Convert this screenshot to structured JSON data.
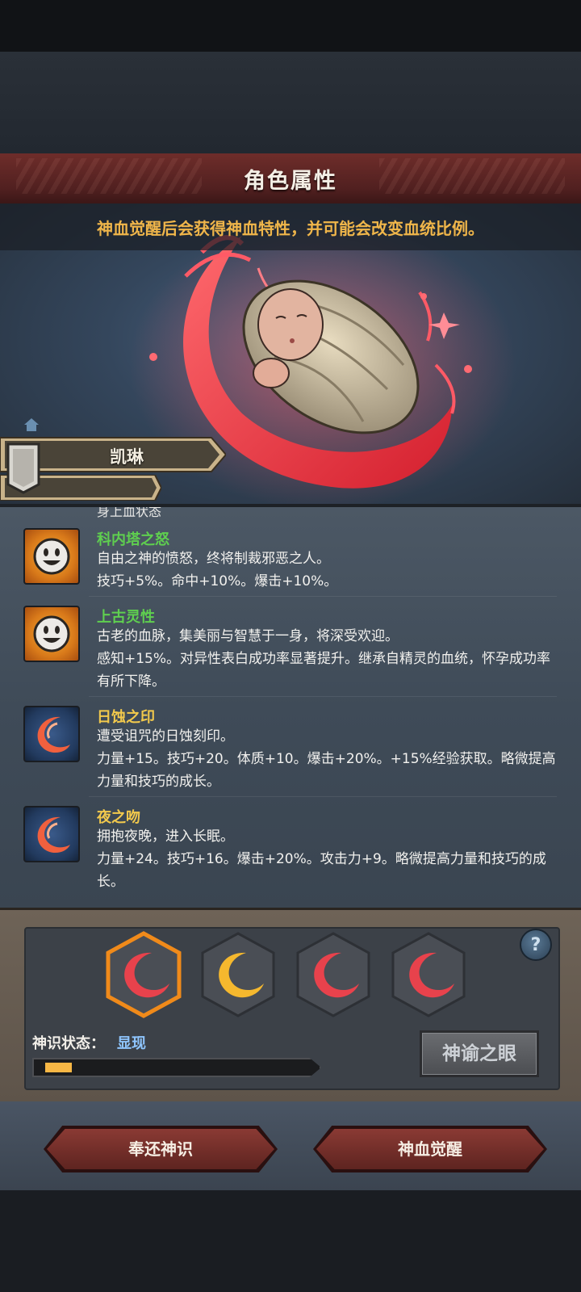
{
  "header": {
    "title": "角色属性"
  },
  "subtitle": "神血觉醒后会获得神血特性，并可能会改变血统比例。",
  "character": {
    "name": "凯琳"
  },
  "traits_list": {
    "clipped_text": "身上血状态",
    "items": [
      {
        "name": "科内塔之怒",
        "name_color": "#5fcf4f",
        "icon": "smiley-sun-icon",
        "description": "自由之神的愤怒，终将制裁邪恶之人。",
        "effects": "技巧+5%。命中+10%。爆击+10%。"
      },
      {
        "name": "上古灵性",
        "name_color": "#5fcf4f",
        "icon": "smiley-sun-icon",
        "description": "古老的血脉，集美丽与智慧于一身，将深受欢迎。",
        "effects": "感知+15%。对异性表白成功率显著提升。继承自精灵的血统，怀孕成功率有所下降。"
      },
      {
        "name": "日蚀之印",
        "name_color": "#f2c94c",
        "icon": "crimson-crescent-icon",
        "description": "遭受诅咒的日蚀刻印。",
        "effects": "力量+15。技巧+20。体质+10。爆击+20%。+15%经验获取。略微提高力量和技巧的成长。"
      },
      {
        "name": "夜之吻",
        "name_color": "#f2c94c",
        "icon": "crimson-crescent-icon",
        "description": "拥抱夜晚，进入长眠。",
        "effects": "力量+24。技巧+16。爆击+20%。攻击力+9。略微提高力量和技巧的成长。"
      }
    ]
  },
  "bloodline_slots": [
    {
      "icon": "red-crescent-icon",
      "color": "#e8424c",
      "selected": true
    },
    {
      "icon": "gold-crescent-icon",
      "color": "#f5b82e",
      "selected": false
    },
    {
      "icon": "red-crescent-icon",
      "color": "#e8424c",
      "selected": false
    },
    {
      "icon": "red-crescent-icon",
      "color": "#e8424c",
      "selected": false
    }
  ],
  "help_label": "?",
  "status": {
    "label": "神识状态：",
    "value": "显现",
    "progress": 0.1
  },
  "eye_button": "神谕之眼",
  "footer": {
    "return_button": "奉还神识",
    "awaken_button": "神血觉醒"
  },
  "colors": {
    "header_red": "#6e2d2a",
    "subtitle_gold": "#f0b64a",
    "status_blue": "#8fc6ff",
    "progress_fill": "#f7b745"
  }
}
